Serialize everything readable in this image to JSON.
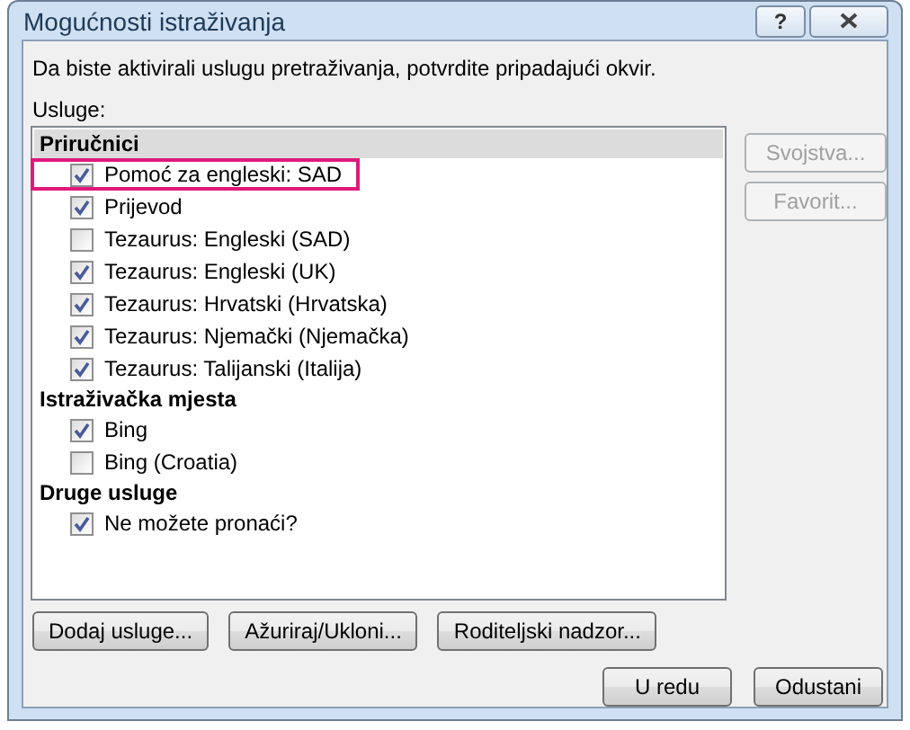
{
  "window": {
    "title": "Mogućnosti istraživanja",
    "help_button": "?"
  },
  "instruction": "Da biste aktivirali uslugu pretraživanja, potvrdite pripadajući okvir.",
  "services_label": "Usluge:",
  "groups": [
    {
      "title": "Priručnici",
      "selected": true,
      "items": [
        {
          "label": "Pomoć za engleski: SAD",
          "checked": true,
          "annotated": true
        },
        {
          "label": "Prijevod",
          "checked": true,
          "annotated": false
        },
        {
          "label": "Tezaurus: Engleski (SAD)",
          "checked": false,
          "annotated": false
        },
        {
          "label": "Tezaurus: Engleski (UK)",
          "checked": true,
          "annotated": false
        },
        {
          "label": "Tezaurus: Hrvatski (Hrvatska)",
          "checked": true,
          "annotated": false
        },
        {
          "label": "Tezaurus: Njemački (Njemačka)",
          "checked": true,
          "annotated": false
        },
        {
          "label": "Tezaurus: Talijanski (Italija)",
          "checked": true,
          "annotated": false
        }
      ]
    },
    {
      "title": "Istraživačka mjesta",
      "selected": false,
      "items": [
        {
          "label": "Bing",
          "checked": true,
          "annotated": false
        },
        {
          "label": "Bing (Croatia)",
          "checked": false,
          "annotated": false
        }
      ]
    },
    {
      "title": "Druge usluge",
      "selected": false,
      "items": [
        {
          "label": "Ne možete pronaći?",
          "checked": true,
          "annotated": false
        }
      ]
    }
  ],
  "side_buttons": [
    {
      "label": "Svojstva...",
      "disabled": true
    },
    {
      "label": "Favorit...",
      "disabled": true
    }
  ],
  "bottom_buttons": [
    {
      "label": "Dodaj usluge..."
    },
    {
      "label": "Ažuriraj/Ukloni..."
    },
    {
      "label": "Roditeljski nadzor..."
    }
  ],
  "dialog_buttons": [
    {
      "label": "U redu"
    },
    {
      "label": "Odustani"
    }
  ]
}
